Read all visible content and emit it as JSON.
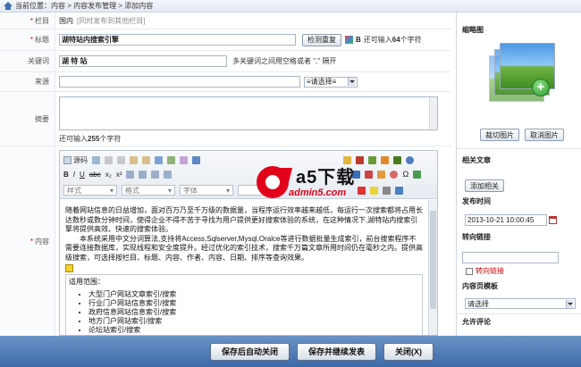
{
  "breadcrumb": {
    "text": "当前位置：内容 > 内容发布管理 > 添加内容"
  },
  "form": {
    "column": {
      "label": "栏目",
      "value": "国内",
      "sync_link": "[同时发布到其他栏目]"
    },
    "title": {
      "label": "标题",
      "value": "湖特站内搜索引擎",
      "check_button": "检测重复",
      "bold_label": "B",
      "hint_prefix": "还可输入",
      "hint_count": "64",
      "hint_suffix": "个字符"
    },
    "keywords": {
      "label": "关键词",
      "value": "湖 特 站",
      "hint": "多关键词之间用空格或者 \",\" 隔开"
    },
    "source": {
      "label": "来源",
      "value": "",
      "select_value": "≡请选择≡"
    },
    "summary": {
      "label": "摘要",
      "hint_prefix": "还可输入",
      "hint_count": "255",
      "hint_suffix": "个字符"
    },
    "content": {
      "label": "内容",
      "toolbar": {
        "source_label": "源码",
        "style_label": "样式",
        "format_label": "格式",
        "font_label": "字体",
        "superscript": "x²",
        "subscript": "x₂",
        "abc": "abc",
        "bold": "B",
        "italic": "I",
        "underline": "U"
      },
      "paragraph1": "随着网站信息的日益增加，面对百万乃至千万级的数据量，当程序运行效率越来越低，每运行一次搜索都将占用长达数秒或数分钟时间，使得企业不得不苦于寻找为用户提供更好搜索体验的系统，在这种情况下,湖特站内搜索引擎将提供高效、快速的搜索体验。",
      "paragraph2": "本系统采用中文分词算法,支持将Access,Sqlserver,Mysql,Oralce等进行数据批量生成索引，前台搜索程序不需要连接数据库，实现线程和安全度提升。经过优化的索引技术，搜索千万篇文章所用时间仍在毫秒之内。提供高级搜索，可选择按栏目、标题、内容、作者、内容、日期、排序等查询效果。",
      "scope_title": "适用范围：",
      "scope_items": [
        "大型门户网站文章索引/搜索",
        "行业门户网站信息索引/搜索",
        "政府信息网站信息索引/搜索",
        "地方门户网站索引/搜索",
        "论坛站索引/搜索"
      ]
    }
  },
  "sidebar": {
    "thumbnail_title": "缩略图",
    "crop_button": "裁切图片",
    "cancel_button": "取消图片",
    "related_title": "相关文章",
    "add_related_button": "添加相关",
    "publish_time_title": "发布时间",
    "publish_time_value": "2013-10-21 10:00:45",
    "redirect_title": "转向链接",
    "redirect_value": "",
    "redirect_checkbox_label": "转向链接",
    "template_title": "内容页模板",
    "template_value": "请选择",
    "comment_title": "允许评论"
  },
  "footer": {
    "save_close": "保存后自动关闭",
    "save_continue": "保存并继续发表",
    "close": "关闭(X)"
  },
  "watermark": {
    "brand": "a5下载",
    "domain": "admin5.com"
  },
  "colors": {
    "required": "#dd0000",
    "footer": "#4a77b0",
    "link_gray": "#8c8c8c",
    "redirect_red": "#cc0000"
  }
}
